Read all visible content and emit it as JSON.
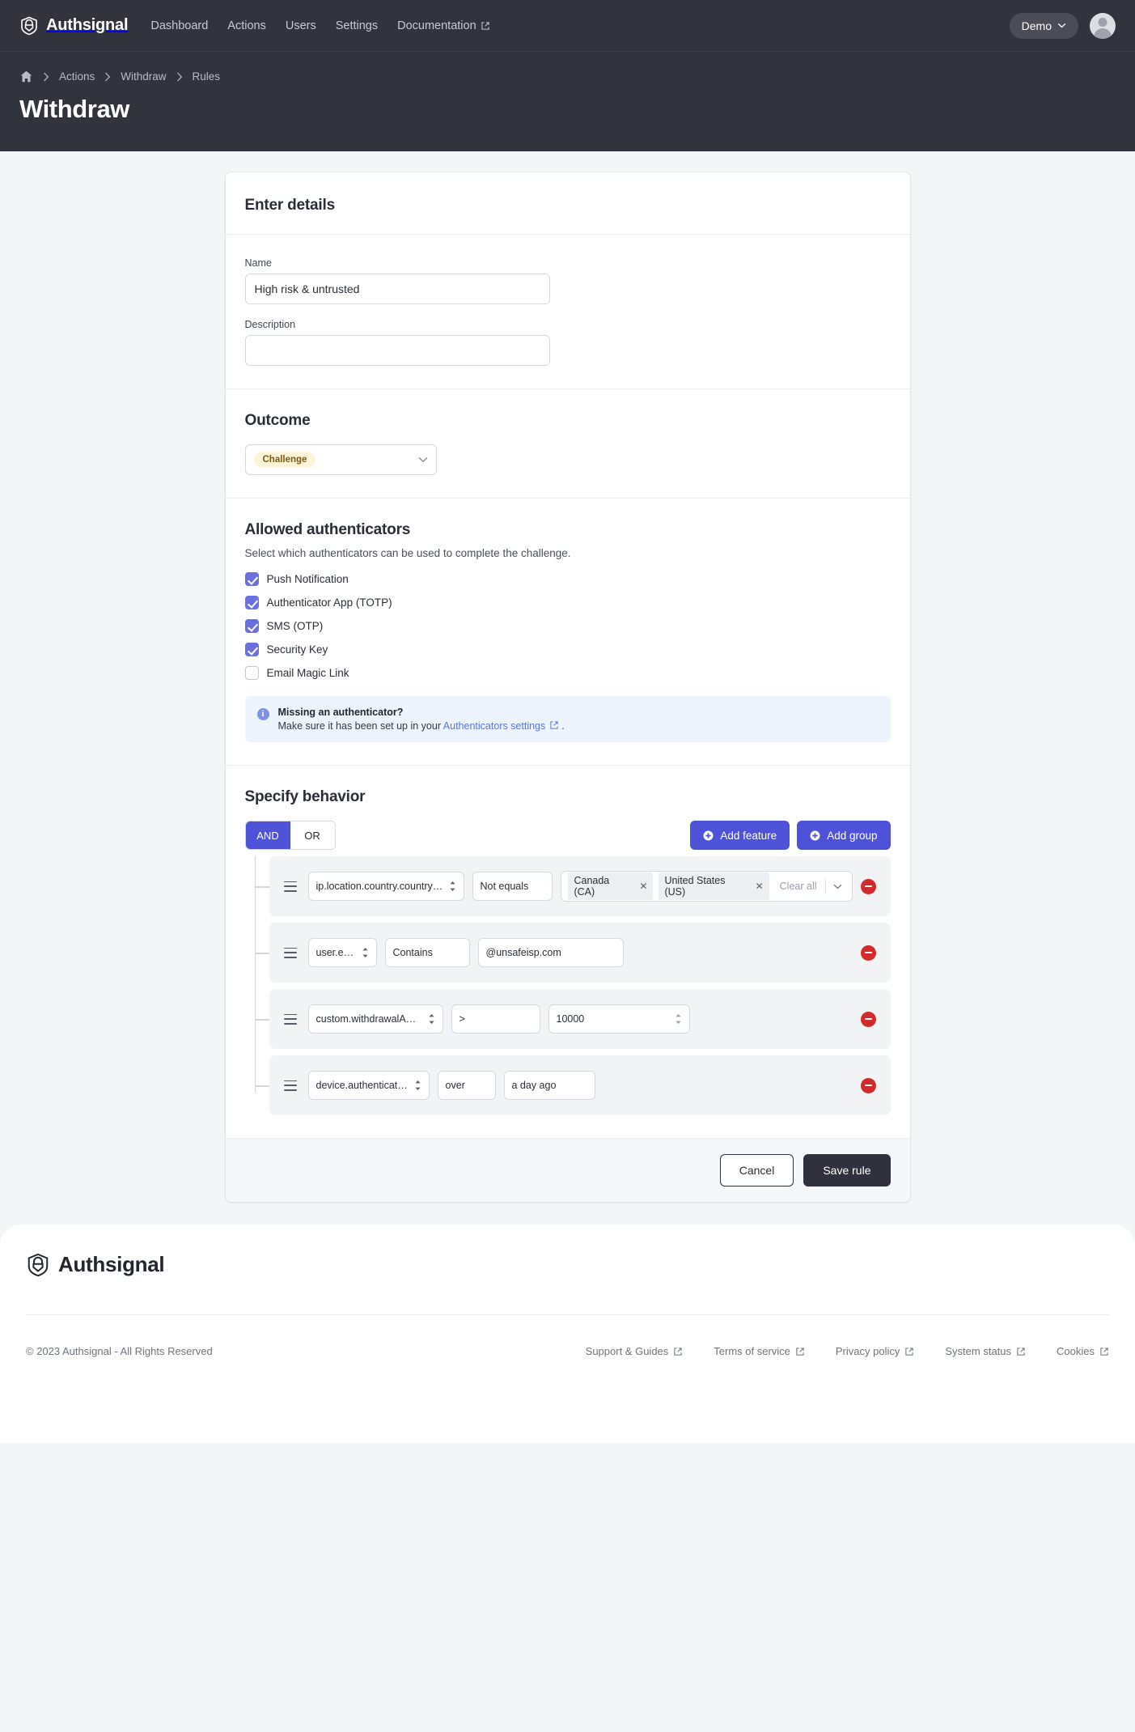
{
  "topnav": {
    "brand": "Authsignal",
    "links": [
      {
        "label": "Dashboard",
        "external": false
      },
      {
        "label": "Actions",
        "external": false
      },
      {
        "label": "Users",
        "external": false
      },
      {
        "label": "Settings",
        "external": false
      },
      {
        "label": "Documentation",
        "external": true
      }
    ],
    "account_label": "Demo"
  },
  "header": {
    "breadcrumbs": [
      "Actions",
      "Withdraw",
      "Rules"
    ],
    "title": "Withdraw"
  },
  "details": {
    "heading": "Enter details",
    "name_label": "Name",
    "name_value": "High risk & untrusted",
    "description_label": "Description",
    "description_value": "",
    "description_placeholder": ""
  },
  "outcome": {
    "heading": "Outcome",
    "selected": "Challenge"
  },
  "authenticators": {
    "heading": "Allowed authenticators",
    "subtext": "Select which authenticators can be used to complete the challenge.",
    "items": [
      {
        "label": "Push Notification",
        "checked": true
      },
      {
        "label": "Authenticator App (TOTP)",
        "checked": true
      },
      {
        "label": "SMS (OTP)",
        "checked": true
      },
      {
        "label": "Security Key",
        "checked": true
      },
      {
        "label": "Email Magic Link",
        "checked": false
      }
    ],
    "info_title": "Missing an authenticator?",
    "info_prefix": "Make sure it has been set up in your ",
    "info_link": "Authenticators settings",
    "info_suffix": "."
  },
  "behavior": {
    "heading": "Specify behavior",
    "operator_and": "AND",
    "operator_or": "OR",
    "selected_operator": "AND",
    "add_feature_label": "Add feature",
    "add_group_label": "Add group",
    "rules": [
      {
        "field": "ip.location.country.countryCode",
        "operator": "Not equals",
        "value_type": "multi",
        "tags": [
          "Canada (CA)",
          "United States (US)"
        ],
        "clear_all_label": "Clear all"
      },
      {
        "field": "user.email",
        "operator": "Contains",
        "value_type": "text",
        "value": "@unsafeisp.com"
      },
      {
        "field": "custom.withdrawalAmount",
        "operator": ">",
        "value_type": "number",
        "value": "10000"
      },
      {
        "field": "device.authenticatedAt",
        "operator": "over",
        "value_type": "select",
        "value": "a day ago"
      }
    ]
  },
  "actions": {
    "cancel_label": "Cancel",
    "save_label": "Save rule"
  },
  "footer": {
    "brand": "Authsignal",
    "copyright": "© 2023 Authsignal - All Rights Reserved",
    "links": [
      {
        "label": "Support & Guides"
      },
      {
        "label": "Terms of service"
      },
      {
        "label": "Privacy policy"
      },
      {
        "label": "System status"
      },
      {
        "label": "Cookies"
      }
    ]
  },
  "colors": {
    "accent": "#4e52d9",
    "checkbox": "#6b70e0",
    "danger": "#d12b2b",
    "dark": "#31333d",
    "challenge_badge_bg": "#fdf3d8",
    "challenge_badge_fg": "#7a5b14",
    "info_bg": "#eef4fd"
  }
}
